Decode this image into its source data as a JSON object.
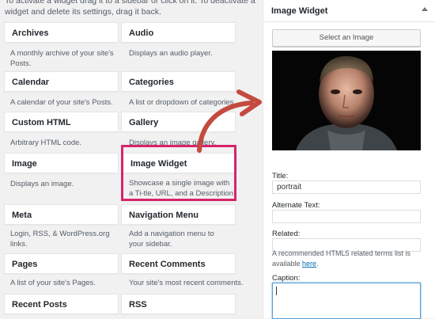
{
  "intro_text": "To activate a widget drag it to a sidebar or click on it. To deactivate a widget and delete its settings, drag it back.",
  "widgets": [
    {
      "title": "Archives",
      "desc": "A monthly archive of your site's Posts."
    },
    {
      "title": "Audio",
      "desc": "Displays an audio player."
    },
    {
      "title": "Calendar",
      "desc": "A calendar of your site's Posts."
    },
    {
      "title": "Categories",
      "desc": "A list or dropdown of categories."
    },
    {
      "title": "Custom HTML",
      "desc": "Arbitrary HTML code."
    },
    {
      "title": "Gallery",
      "desc": "Displays an image gallery."
    },
    {
      "title": "Image",
      "desc": "Displays an image."
    },
    {
      "title": "Image Widget",
      "desc": "Showcase a single image with a Ti-tle, URL, and a Description"
    },
    {
      "title": "Meta",
      "desc": "Login, RSS, & WordPress.org links."
    },
    {
      "title": "Navigation Menu",
      "desc": "Add a navigation menu to your sidebar."
    },
    {
      "title": "Pages",
      "desc": "A list of your site's Pages."
    },
    {
      "title": "Recent Comments",
      "desc": "Your site's most recent comments."
    },
    {
      "title": "Recent Posts",
      "desc": ""
    },
    {
      "title": "RSS",
      "desc": ""
    }
  ],
  "panel": {
    "title": "Image Widget",
    "select_button": "Select an Image",
    "title_label": "Title:",
    "title_value": "portrait",
    "alt_label": "Alternate Text:",
    "alt_value": "",
    "related_label": "Related:",
    "related_value": "",
    "related_note": "A recommended HTML5 related terms list is available",
    "related_link": "here",
    "caption_label": "Caption:"
  },
  "colors": {
    "highlight": "#d7246c",
    "arrow": "#c44a3f",
    "link": "#0073aa"
  }
}
